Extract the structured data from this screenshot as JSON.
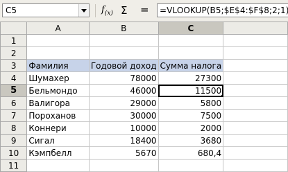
{
  "formula_bar": {
    "name_box": "C5",
    "fx_label": "f",
    "fx_sub": "(x)",
    "sum_label": "Σ",
    "equals_label": "=",
    "formula": "=VLOOKUP(B5;$E$4:$F$8;2;1)*B5"
  },
  "grid": {
    "columns": [
      "A",
      "B",
      "C"
    ],
    "row_numbers": [
      "1",
      "2",
      "3",
      "4",
      "5",
      "6",
      "7",
      "8",
      "9",
      "10",
      "11"
    ],
    "selected_column": "C",
    "selected_row": "5",
    "headers": {
      "name": "Фамилия",
      "income": "Годовой доход",
      "tax": "Сумма налога"
    },
    "rows": [
      {
        "name": "Шумахер",
        "income": "78000",
        "tax": "27300"
      },
      {
        "name": "Бельмондо",
        "income": "46000",
        "tax": "11500"
      },
      {
        "name": "Валигора",
        "income": "29000",
        "tax": "5800"
      },
      {
        "name": "Пороханов",
        "income": "30000",
        "tax": "7500"
      },
      {
        "name": "Коннери",
        "income": "10000",
        "tax": "2000"
      },
      {
        "name": "Сигал",
        "income": "18400",
        "tax": "3680"
      },
      {
        "name": "Кэмпбелл",
        "income": "5670",
        "tax": "680,4"
      }
    ]
  },
  "colors": {
    "header_highlight": "#c7d3e9",
    "selected_header": "#c9c7bf"
  }
}
